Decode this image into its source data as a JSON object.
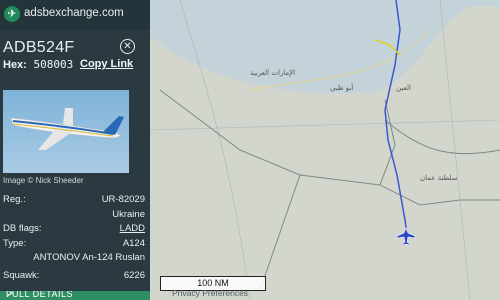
{
  "app": {
    "logo_text": "adsbexchange.com"
  },
  "aircraft": {
    "ident": "ADB524F",
    "hex_label": "Hex:",
    "hex_value": "508003",
    "copy_link": "Copy Link",
    "image_credit": "Image © Nick Sheeder",
    "rows": [
      {
        "label": "Reg.:",
        "value": "UR-82029"
      },
      {
        "label": "",
        "value": "Ukraine"
      },
      {
        "label": "DB flags:",
        "value": "LADD"
      },
      {
        "label": "Type:",
        "value": "A124"
      },
      {
        "label": "",
        "value": "ANTONOV An-124 Ruslan"
      },
      {
        "label": "Squawk:",
        "value": "6226"
      }
    ],
    "full_details": "FULL DETAILS"
  },
  "map": {
    "scale_label": "100 NM",
    "privacy": "Privacy Preferences",
    "labels": {
      "abu_dhabi": "أبو ظبي",
      "uae": "الإمارات العربية",
      "oman": "سلطنة عمان",
      "al_ain": "العين"
    }
  },
  "colors": {
    "sidebar": "#2b3a40",
    "track": "#3a56d8",
    "accent": "#2f8e63"
  },
  "icons": {
    "logo": "plane-logo-icon",
    "close": "close-circle-icon",
    "external": "external-link-icon"
  }
}
